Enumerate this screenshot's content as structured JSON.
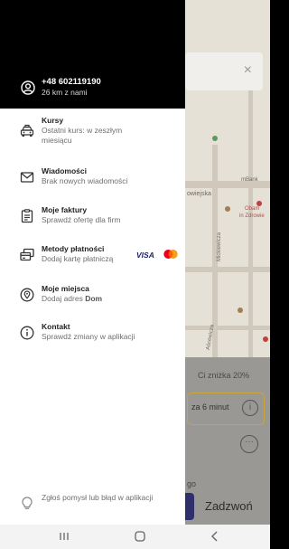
{
  "drawer": {
    "header": {
      "phone": "+48 602119190",
      "subtitle": "26 km z nami"
    },
    "items": [
      {
        "title": "Kursy",
        "desc": "Ostatni kurs: w zeszłym miesiącu",
        "icon": "taxi-icon"
      },
      {
        "title": "Wiadomości",
        "desc": "Brak nowych wiadomości",
        "icon": "envelope-icon"
      },
      {
        "title": "Moje faktury",
        "desc": "Sprawdź ofertę dla firm",
        "icon": "invoice-icon"
      },
      {
        "title": "Metody płatności",
        "desc": "Dodaj kartę płatniczą",
        "icon": "card-icon"
      },
      {
        "title": "Moje miejsca",
        "desc_prefix": "Dodaj adres ",
        "desc_bold": "Dom",
        "icon": "location-pin-icon"
      },
      {
        "title": "Kontakt",
        "desc": "Sprawdź zmiany w aplikacji",
        "icon": "info-icon"
      }
    ],
    "payment_brands": {
      "visa": "VISA",
      "mastercard": "mastercard-icon"
    },
    "feedback": {
      "text": "Zgłoś pomysł lub błąd w aplikacji",
      "icon": "lightbulb-icon"
    }
  },
  "background": {
    "map_labels": [
      "owiejska",
      "mBank",
      "Obam",
      "in Zdrowie",
      "Mickiewicza",
      "Aścewicza"
    ],
    "promo": "Ci zniżka 20%",
    "eta": "za 6 minut",
    "go_label": "go",
    "call_button": "Zadzwoń"
  },
  "navbar": {
    "recent": "recent-apps-icon",
    "home": "home-icon",
    "back": "back-icon"
  },
  "colors": {
    "header_bg": "#000000",
    "drawer_bg": "#ffffff",
    "accent_gold": "#c8a63a",
    "visa_blue": "#1a1f71"
  }
}
